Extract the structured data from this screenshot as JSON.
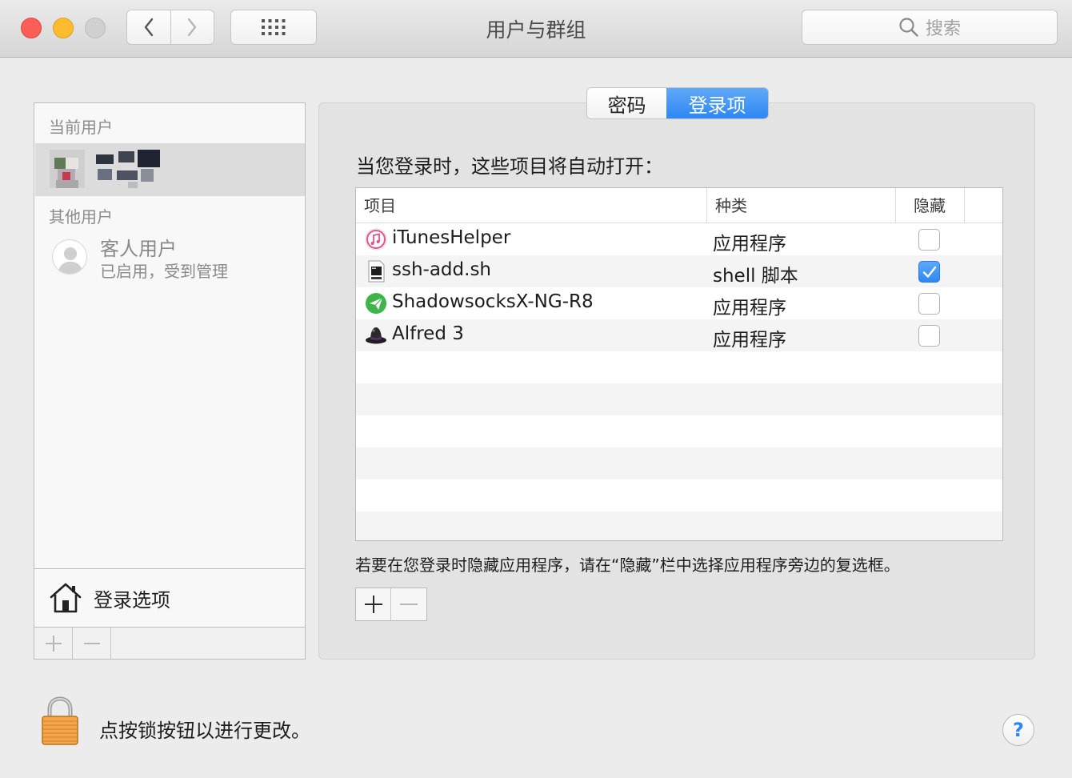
{
  "window": {
    "title": "用户与群组"
  },
  "toolbar": {
    "search_placeholder": "搜索"
  },
  "sidebar": {
    "current_users_header": "当前用户",
    "other_users_header": "其他用户",
    "guest": {
      "name": "客人用户",
      "status": "已启用，受到管理"
    },
    "login_options_label": "登录选项"
  },
  "tabs": {
    "password": "密码",
    "login_items": "登录项"
  },
  "main": {
    "intro": "当您登录时，这些项目将自动打开：",
    "columns": {
      "item": "项目",
      "kind": "种类",
      "hide": "隐藏"
    },
    "rows": [
      {
        "name": "iTunesHelper",
        "kind": "应用程序",
        "hidden": false,
        "icon": "itunes-icon"
      },
      {
        "name": "ssh-add.sh",
        "kind": "shell 脚本",
        "hidden": true,
        "icon": "shell-script-icon"
      },
      {
        "name": "ShadowsocksX-NG-R8",
        "kind": "应用程序",
        "hidden": false,
        "icon": "shadowsocks-icon"
      },
      {
        "name": "Alfred 3",
        "kind": "应用程序",
        "hidden": false,
        "icon": "alfred-icon"
      }
    ],
    "hint": "若要在您登录时隐藏应用程序，请在“隐藏”栏中选择应用程序旁边的复选框。"
  },
  "footer": {
    "lock_text": "点按锁按钮以进行更改。",
    "help": "?"
  },
  "colors": {
    "accent": "#2f86f3",
    "close": "#fc5f57",
    "minimize": "#fdbc2e"
  }
}
